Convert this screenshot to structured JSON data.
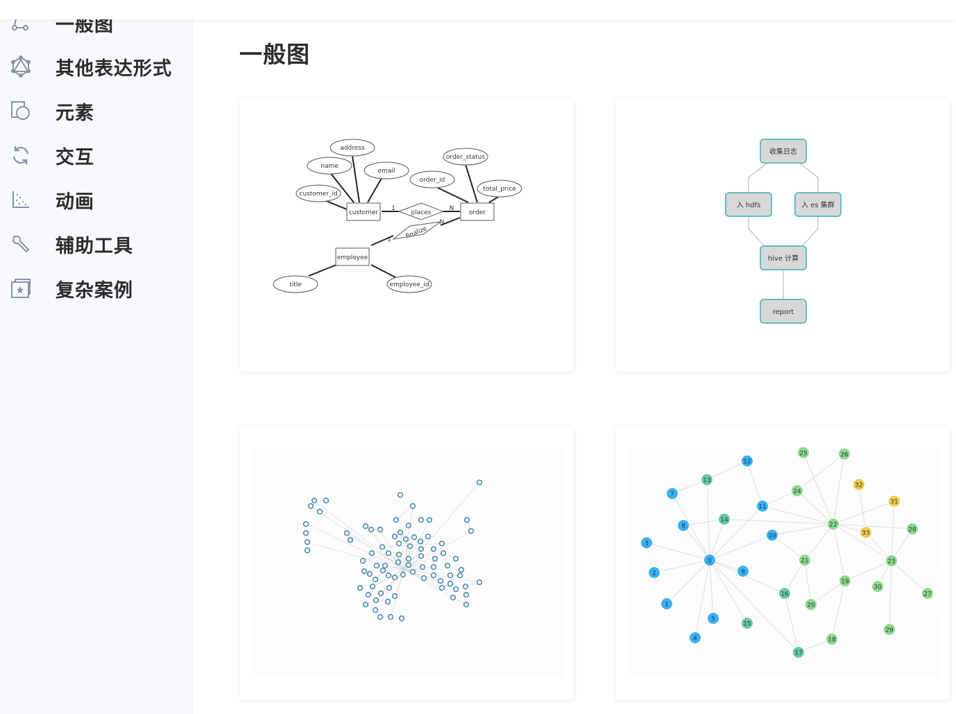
{
  "sidebar": {
    "items": [
      {
        "label": "一般图",
        "icon": "graph-nodes-icon"
      },
      {
        "label": "其他表达形式",
        "icon": "hexagon-graph-icon"
      },
      {
        "label": "元素",
        "icon": "shapes-icon"
      },
      {
        "label": "交互",
        "icon": "refresh-icon"
      },
      {
        "label": "动画",
        "icon": "scatter-animation-icon"
      },
      {
        "label": "辅助工具",
        "icon": "wrench-icon"
      },
      {
        "label": "复杂案例",
        "icon": "star-document-icon"
      }
    ]
  },
  "main": {
    "title": "一般图",
    "cards": [
      {
        "name": "er-diagram",
        "entities": [
          "customer",
          "order",
          "employee"
        ],
        "relations": [
          "places",
          "finalize"
        ],
        "attributes": [
          "address",
          "name",
          "email",
          "customer_id",
          "order_status",
          "order_id",
          "total_price",
          "title",
          "employee_id"
        ],
        "cardinality": [
          "1",
          "N",
          "1",
          "N"
        ]
      },
      {
        "name": "flow-diagram",
        "nodes": [
          "收集日志",
          "入 hdfs",
          "入 es 集群",
          "hive 计算",
          "report"
        ]
      },
      {
        "name": "force-graph"
      },
      {
        "name": "numbered-graph",
        "colors": {
          "blue": "#3ab0f2",
          "green": "#8fd98a",
          "teal": "#6cc9a6",
          "yellow": "#f2c94c"
        },
        "nodes": [
          {
            "id": "0",
            "c": "blue"
          },
          {
            "id": "1",
            "c": "blue"
          },
          {
            "id": "2",
            "c": "blue"
          },
          {
            "id": "3",
            "c": "blue"
          },
          {
            "id": "4",
            "c": "blue"
          },
          {
            "id": "5",
            "c": "blue"
          },
          {
            "id": "7",
            "c": "blue"
          },
          {
            "id": "8",
            "c": "blue"
          },
          {
            "id": "9",
            "c": "blue"
          },
          {
            "id": "10",
            "c": "blue"
          },
          {
            "id": "11",
            "c": "blue"
          },
          {
            "id": "12",
            "c": "blue"
          },
          {
            "id": "13",
            "c": "teal"
          },
          {
            "id": "14",
            "c": "teal"
          },
          {
            "id": "15",
            "c": "teal"
          },
          {
            "id": "16",
            "c": "teal"
          },
          {
            "id": "17",
            "c": "teal"
          },
          {
            "id": "18",
            "c": "green"
          },
          {
            "id": "19",
            "c": "green"
          },
          {
            "id": "20",
            "c": "green"
          },
          {
            "id": "21",
            "c": "green"
          },
          {
            "id": "22",
            "c": "green"
          },
          {
            "id": "23",
            "c": "green"
          },
          {
            "id": "24",
            "c": "green"
          },
          {
            "id": "25",
            "c": "green"
          },
          {
            "id": "26",
            "c": "green"
          },
          {
            "id": "27",
            "c": "green"
          },
          {
            "id": "28",
            "c": "green"
          },
          {
            "id": "29",
            "c": "green"
          },
          {
            "id": "30",
            "c": "green"
          },
          {
            "id": "31",
            "c": "yellow"
          },
          {
            "id": "32",
            "c": "yellow"
          },
          {
            "id": "33",
            "c": "yellow"
          }
        ]
      }
    ]
  }
}
